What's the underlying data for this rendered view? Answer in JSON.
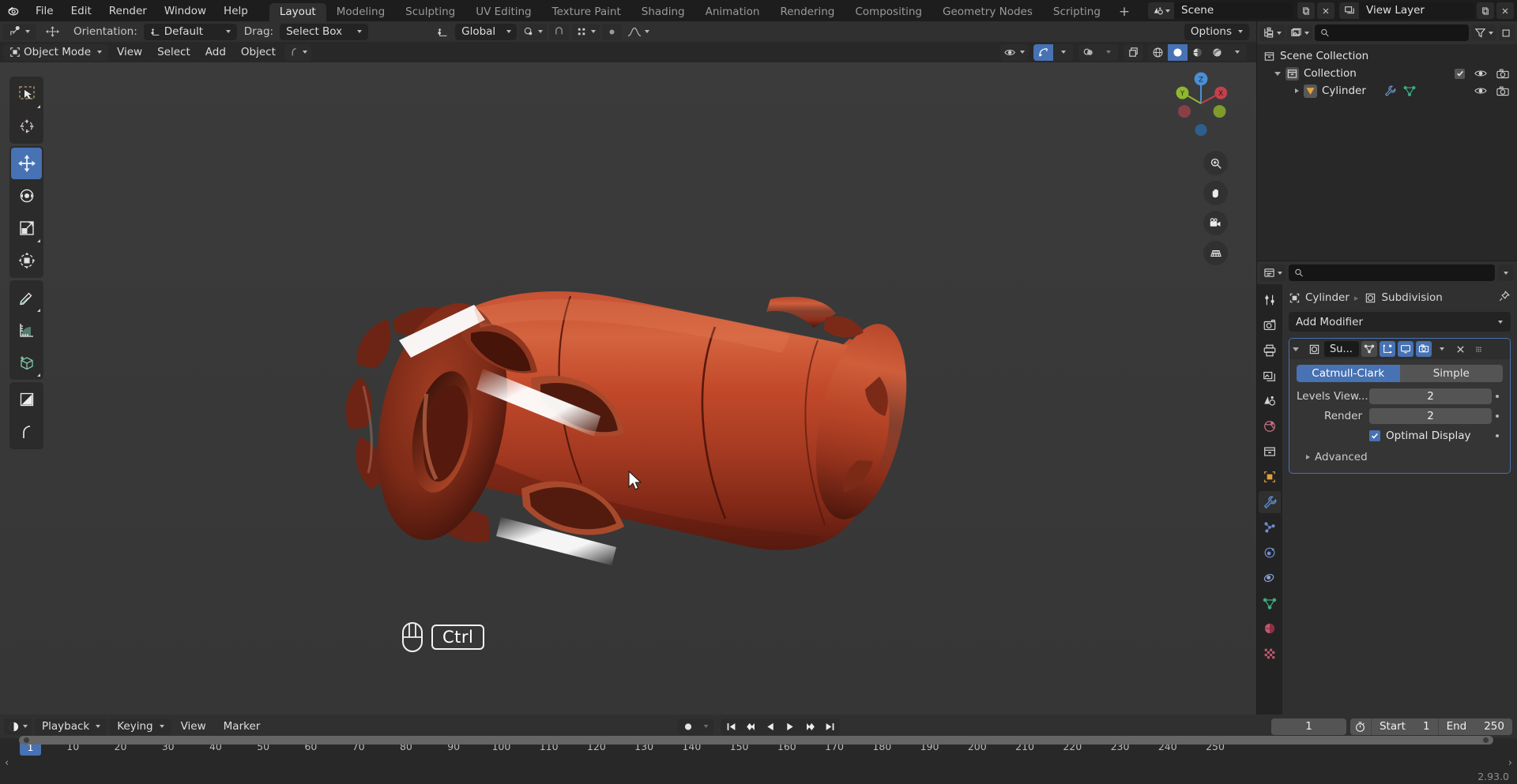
{
  "app": {
    "name": "Blender",
    "version": "2.93.0"
  },
  "topbar": {
    "menus": [
      "File",
      "Edit",
      "Render",
      "Window",
      "Help"
    ],
    "workspaces": [
      {
        "label": "Layout",
        "active": true
      },
      {
        "label": "Modeling",
        "active": false
      },
      {
        "label": "Sculpting",
        "active": false
      },
      {
        "label": "UV Editing",
        "active": false
      },
      {
        "label": "Texture Paint",
        "active": false
      },
      {
        "label": "Shading",
        "active": false
      },
      {
        "label": "Animation",
        "active": false
      },
      {
        "label": "Rendering",
        "active": false
      },
      {
        "label": "Compositing",
        "active": false
      },
      {
        "label": "Geometry Nodes",
        "active": false
      },
      {
        "label": "Scripting",
        "active": false
      }
    ],
    "add_workspace_label": "+",
    "scene_name": "Scene",
    "view_layer_name": "View Layer"
  },
  "viewport_header": {
    "orientation_label": "Orientation:",
    "orientation_value": "Default",
    "drag_label": "Drag:",
    "drag_value": "Select Box",
    "transform_space": "Global",
    "options_label": "Options",
    "mode": "Object Mode",
    "menus": [
      "View",
      "Select",
      "Add",
      "Object"
    ]
  },
  "toolbar": {
    "tools": [
      {
        "name": "tweak-tool",
        "active": false
      },
      {
        "name": "cursor-tool",
        "active": false
      },
      {
        "name": "move-tool",
        "active": true
      },
      {
        "name": "rotate-tool",
        "active": false
      },
      {
        "name": "scale-tool",
        "active": false
      },
      {
        "name": "transform-tool",
        "active": false
      },
      {
        "name": "annotate-tool",
        "active": false
      },
      {
        "name": "measure-tool",
        "active": false
      },
      {
        "name": "add-cube-tool",
        "active": false
      },
      {
        "name": "shear-tool",
        "active": false
      },
      {
        "name": "spin-tool",
        "active": false
      }
    ]
  },
  "gizmo": {
    "axes": [
      "Z",
      "Y",
      "X"
    ]
  },
  "key_overlay": {
    "mouse": "mouse-icon",
    "key": "Ctrl"
  },
  "outliner": {
    "search_placeholder": "",
    "rows": [
      {
        "label": "Scene Collection",
        "icon": "scene-collection-icon",
        "indent": 0,
        "expand": "none",
        "checkbox": false,
        "eye": false,
        "camera": false
      },
      {
        "label": "Collection",
        "icon": "collection-icon",
        "indent": 1,
        "expand": "open",
        "checkbox": true,
        "eye": true,
        "camera": true
      },
      {
        "label": "Cylinder",
        "icon": "mesh-data-icon",
        "indent": 2,
        "expand": "closed",
        "checkbox": false,
        "eye": true,
        "camera": true,
        "extra_icons": [
          "wrench-icon",
          "mesh-triangle-icon"
        ]
      }
    ]
  },
  "properties": {
    "search_placeholder": "",
    "breadcrumb": [
      {
        "label": "Cylinder",
        "icon": "object-icon"
      },
      {
        "label": "Subdivision",
        "icon": "modifier-circle-icon"
      }
    ],
    "add_modifier_label": "Add Modifier",
    "modifier": {
      "name_short": "Su...",
      "name_full": "Subdivision",
      "subdivision_types": [
        {
          "label": "Catmull-Clark",
          "active": true
        },
        {
          "label": "Simple",
          "active": false
        }
      ],
      "levels_viewport_label": "Levels View...",
      "levels_viewport_value": "2",
      "render_label": "Render",
      "render_value": "2",
      "optimal_display_label": "Optimal Display",
      "optimal_display_checked": true,
      "advanced_label": "Advanced",
      "header_toggles": [
        {
          "name": "edit-mode-display-toggle",
          "on": false
        },
        {
          "name": "on-cage-toggle",
          "on": true
        },
        {
          "name": "realtime-display-toggle",
          "on": true
        },
        {
          "name": "render-display-toggle",
          "on": true
        }
      ]
    },
    "tabs": [
      {
        "name": "tool-tab",
        "active": false
      },
      {
        "name": "render-tab",
        "active": false
      },
      {
        "name": "output-tab",
        "active": false
      },
      {
        "name": "view-layer-tab",
        "active": false
      },
      {
        "name": "scene-tab",
        "active": false
      },
      {
        "name": "world-tab",
        "active": false
      },
      {
        "name": "collection-tab",
        "active": false
      },
      {
        "name": "object-tab",
        "active": false
      },
      {
        "name": "modifier-tab",
        "active": true
      },
      {
        "name": "particles-tab",
        "active": false
      },
      {
        "name": "physics-tab",
        "active": false
      },
      {
        "name": "constraints-tab",
        "active": false
      },
      {
        "name": "object-data-tab",
        "active": false
      },
      {
        "name": "material-tab",
        "active": false
      },
      {
        "name": "texture-tab",
        "active": false
      }
    ]
  },
  "timeline": {
    "menus": [
      {
        "label": "Playback",
        "dropdown": true
      },
      {
        "label": "Keying",
        "dropdown": true
      },
      {
        "label": "View",
        "dropdown": false
      },
      {
        "label": "Marker",
        "dropdown": false
      }
    ],
    "current_frame": "1",
    "start_label": "Start",
    "start_value": "1",
    "end_label": "End",
    "end_value": "250",
    "ticks": [
      1,
      10,
      20,
      30,
      40,
      50,
      60,
      70,
      80,
      90,
      100,
      110,
      120,
      130,
      140,
      150,
      160,
      170,
      180,
      190,
      200,
      210,
      220,
      230,
      240,
      250
    ],
    "playhead_frame": "1"
  },
  "colors": {
    "accent": "#4772b3",
    "panel_bg": "#303030",
    "dark_bg": "#282828",
    "viewport_bg": "#393939",
    "object_base": "#c04a2a"
  }
}
